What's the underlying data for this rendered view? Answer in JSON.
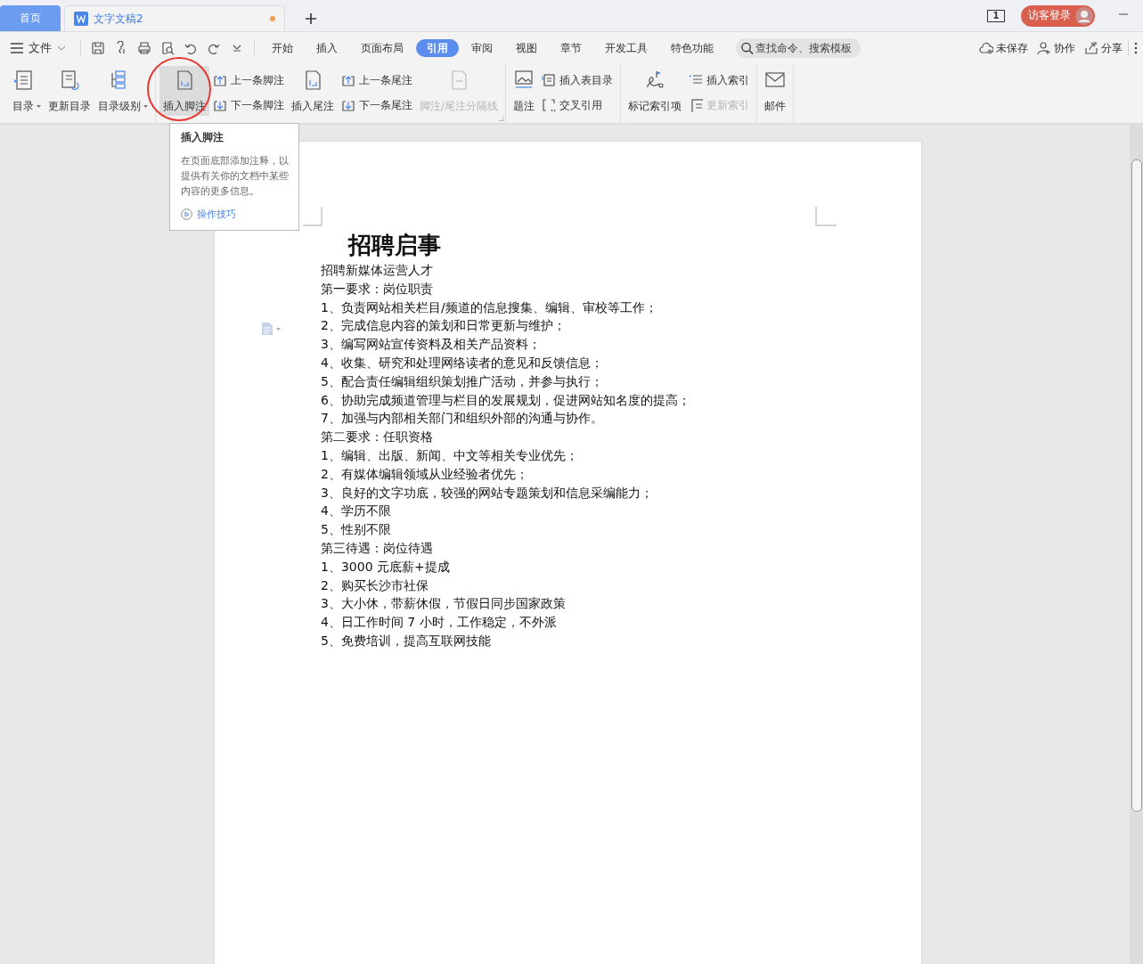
{
  "tabs": [
    {
      "label": "首页",
      "kind": "home",
      "selected": false,
      "modified": false
    },
    {
      "label": "文字文稿2",
      "kind": "doc",
      "selected": true,
      "modified": true
    }
  ],
  "title_bar": {
    "page_count": "1",
    "login_button": "访客登录"
  },
  "menu": {
    "file_menu": "文件",
    "ribbon_tabs": [
      {
        "label": "开始",
        "selected": false
      },
      {
        "label": "插入",
        "selected": false
      },
      {
        "label": "页面布局",
        "selected": false
      },
      {
        "label": "引用",
        "selected": true
      },
      {
        "label": "审阅",
        "selected": false
      },
      {
        "label": "视图",
        "selected": false
      },
      {
        "label": "章节",
        "selected": false
      },
      {
        "label": "开发工具",
        "selected": false
      },
      {
        "label": "特色功能",
        "selected": false
      }
    ],
    "search": {
      "placeholder": "查找命令、搜索模板"
    },
    "actions": [
      {
        "label": "未保存",
        "kind": "cloud"
      },
      {
        "label": "协作",
        "kind": "user"
      },
      {
        "label": "分享",
        "kind": "share"
      }
    ]
  },
  "ribbon": [
    {
      "items": [
        {
          "kind": "large",
          "label": "目录",
          "dropdown": true,
          "disabled": false,
          "hovered": false
        },
        {
          "kind": "large",
          "label": "更新目录",
          "disabled": false,
          "hovered": false
        },
        {
          "kind": "large",
          "label": "目录级别",
          "dropdown": true,
          "disabled": false,
          "hovered": false
        }
      ]
    },
    {
      "launcher": true,
      "items": [
        {
          "kind": "large",
          "label": "插入脚注",
          "disabled": false,
          "hovered": true,
          "circled": true
        },
        {
          "kind": "stack",
          "items": [
            {
              "label": "上一条脚注",
              "disabled": false
            },
            {
              "label": "下一条脚注",
              "disabled": false
            }
          ]
        },
        {
          "kind": "large",
          "label": "插入尾注",
          "disabled": false,
          "hovered": false
        },
        {
          "kind": "stack",
          "items": [
            {
              "label": "上一条尾注",
              "disabled": false
            },
            {
              "label": "下一条尾注",
              "disabled": false
            }
          ]
        },
        {
          "kind": "large",
          "label": "脚注/尾注分隔线",
          "disabled": true,
          "hovered": false
        }
      ]
    },
    {
      "items": [
        {
          "kind": "large",
          "label": "题注",
          "disabled": false,
          "hovered": false
        },
        {
          "kind": "stack",
          "items": [
            {
              "label": "插入表目录",
              "disabled": false
            },
            {
              "label": "交叉引用",
              "disabled": false
            }
          ]
        }
      ]
    },
    {
      "items": [
        {
          "kind": "large",
          "label": "标记索引项",
          "disabled": false,
          "hovered": false
        },
        {
          "kind": "stack",
          "items": [
            {
              "label": "插入索引",
              "disabled": false
            },
            {
              "label": "更新索引",
              "disabled": true
            }
          ]
        }
      ]
    },
    {
      "items": [
        {
          "kind": "large",
          "label": "邮件",
          "disabled": false,
          "hovered": false
        }
      ]
    }
  ],
  "tooltip": {
    "title": "插入脚注",
    "body": "在页面底部添加注释，以提供有关你的文档中某些内容的更多信息。",
    "link": "操作技巧"
  },
  "document": {
    "title": "招聘启事",
    "lines": [
      "招聘新媒体运营人才",
      "第一要求：岗位职责",
      "1、负责网站相关栏目/频道的信息搜集、编辑、审校等工作；",
      "2、完成信息内容的策划和日常更新与维护；",
      "3、编写网站宣传资料及相关产品资料；",
      "4、收集、研究和处理网络读者的意见和反馈信息；",
      "5、配合责任编辑组织策划推广活动，并参与执行；",
      "6、协助完成频道管理与栏目的发展规划，促进网站知名度的提高；",
      "7、加强与内部相关部门和组织外部的沟通与协作。",
      "第二要求：任职资格",
      "1、编辑、出版、新闻、中文等相关专业优先；",
      "2、有媒体编辑领域从业经验者优先；",
      "3、良好的文字功底，较强的网站专题策划和信息采编能力；",
      "4、学历不限",
      "5、性别不限",
      "第三待遇：岗位待遇",
      "1、3000 元底薪+提成",
      "2、购买长沙市社保",
      "3、大小休，带薪休假，节假日同步国家政策",
      "4、日工作时间 7 小时，工作稳定，不外派",
      "5、免费培训，提高互联网技能"
    ]
  }
}
